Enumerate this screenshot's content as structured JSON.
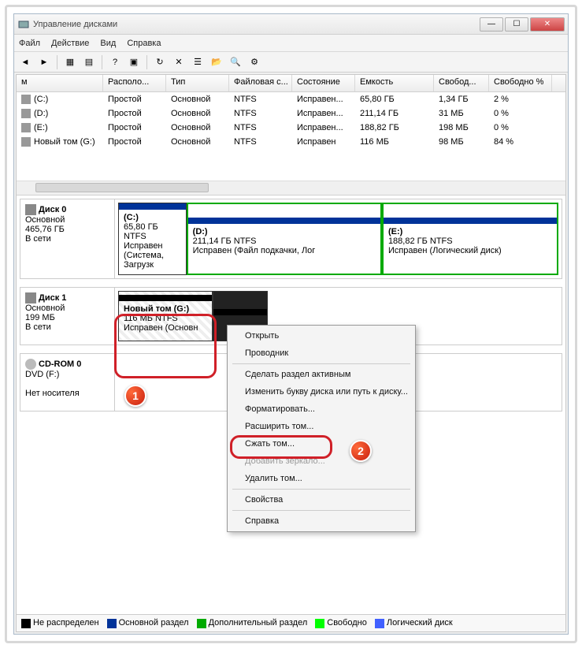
{
  "window": {
    "title": "Управление дисками"
  },
  "menu": {
    "file": "Файл",
    "action": "Действие",
    "view": "Вид",
    "help": "Справка"
  },
  "columns": {
    "name": "м",
    "layout": "Располо...",
    "type": "Тип",
    "fs": "Файловая с...",
    "status": "Состояние",
    "capacity": "Емкость",
    "free": "Свобод...",
    "pct": "Свободно %"
  },
  "volumes": [
    {
      "name": "(C:)",
      "layout": "Простой",
      "type": "Основной",
      "fs": "NTFS",
      "status": "Исправен...",
      "cap": "65,80 ГБ",
      "free": "1,34 ГБ",
      "pct": "2 %"
    },
    {
      "name": "(D:)",
      "layout": "Простой",
      "type": "Основной",
      "fs": "NTFS",
      "status": "Исправен...",
      "cap": "211,14 ГБ",
      "free": "31 МБ",
      "pct": "0 %"
    },
    {
      "name": "(E:)",
      "layout": "Простой",
      "type": "Основной",
      "fs": "NTFS",
      "status": "Исправен...",
      "cap": "188,82 ГБ",
      "free": "198 МБ",
      "pct": "0 %"
    },
    {
      "name": "Новый том  (G:)",
      "layout": "Простой",
      "type": "Основной",
      "fs": "NTFS",
      "status": "Исправен",
      "cap": "116 МБ",
      "free": "98 МБ",
      "pct": "84 %"
    }
  ],
  "disks": {
    "d0": {
      "label": "Диск 0",
      "type": "Основной",
      "size": "465,76 ГБ",
      "state": "В сети",
      "c": {
        "title": "(C:)",
        "line1": "65,80 ГБ NTFS",
        "line2": "Исправен (Система, Загрузк"
      },
      "d": {
        "title": "(D:)",
        "line1": "211,14 ГБ NTFS",
        "line2": "Исправен (Файл подкачки, Лог"
      },
      "e": {
        "title": "(E:)",
        "line1": "188,82 ГБ NTFS",
        "line2": "Исправен (Логический диск)"
      }
    },
    "d1": {
      "label": "Диск 1",
      "type": "Основной",
      "size": "199 МБ",
      "state": "В сети",
      "g": {
        "title": "Новый том  (G:)",
        "line1": "116 МБ NTFS",
        "line2": "Исправен (Основн"
      }
    },
    "cd": {
      "label": "CD-ROM 0",
      "sub": "DVD (F:)",
      "state": "Нет носителя"
    }
  },
  "context": {
    "open": "Открыть",
    "explorer": "Проводник",
    "active": "Сделать раздел активным",
    "change": "Изменить букву диска или путь к диску...",
    "format": "Форматировать...",
    "extend": "Расширить том...",
    "shrink": "Сжать том...",
    "mirror": "Добавить зеркало...",
    "delete": "Удалить том...",
    "props": "Свойства",
    "help": "Справка"
  },
  "legend": {
    "unalloc": "Не распределен",
    "primary": "Основной раздел",
    "ext": "Дополнительный раздел",
    "free": "Свободно",
    "logical": "Логический диск"
  },
  "badges": {
    "one": "1",
    "two": "2"
  }
}
